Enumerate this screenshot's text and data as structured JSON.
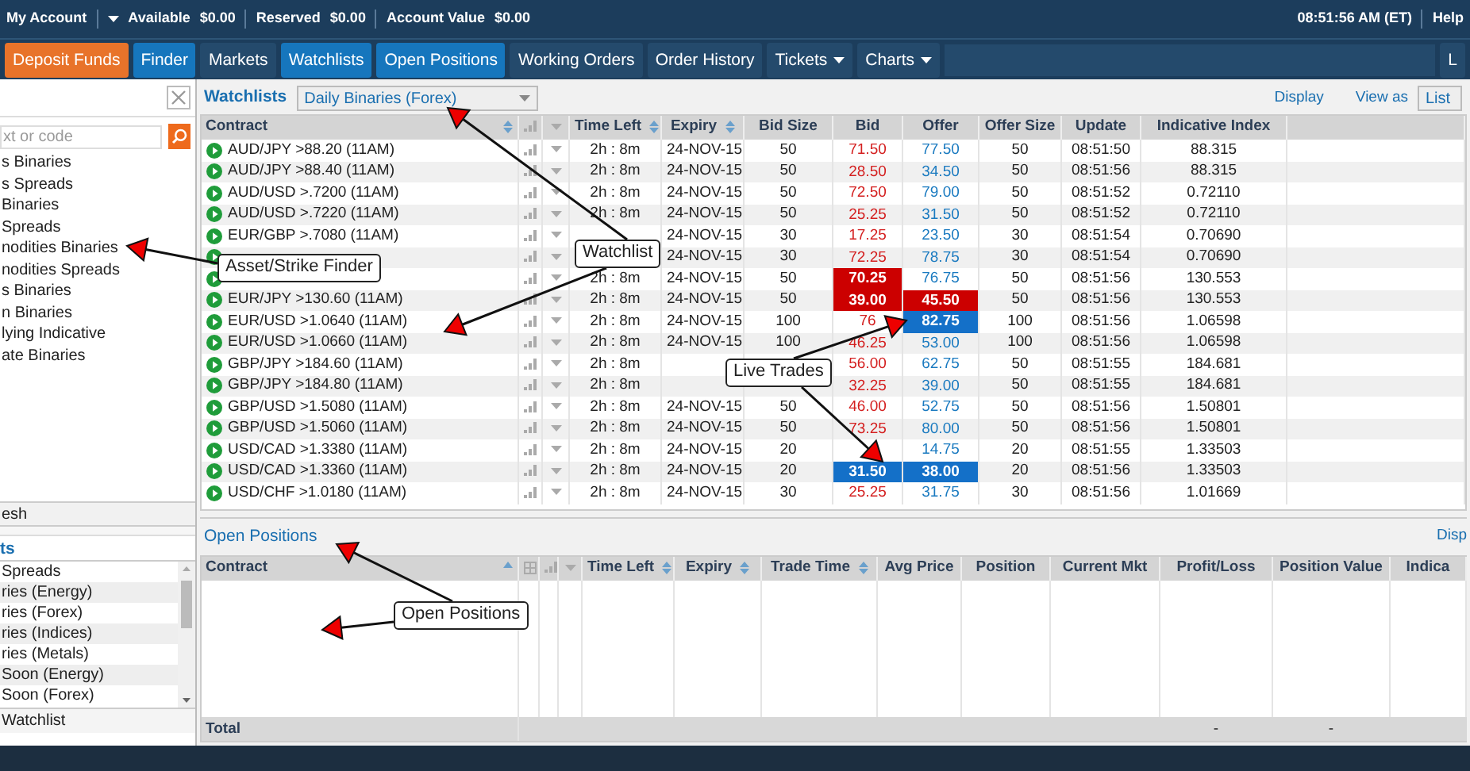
{
  "account_bar": {
    "account_menu": "My Account",
    "balances": [
      {
        "label": "Available",
        "value": "$0.00"
      },
      {
        "label": "Reserved",
        "value": "$0.00"
      },
      {
        "label": "Account Value",
        "value": "$0.00"
      }
    ],
    "clock": "08:51:56 AM (ET)",
    "help": "Help"
  },
  "nav": [
    {
      "label": "Deposit Funds",
      "kind": "action",
      "selected": false,
      "dropdown": false
    },
    {
      "label": "Finder",
      "kind": "tab",
      "selected": true,
      "dropdown": false
    },
    {
      "label": "Markets",
      "kind": "tab",
      "selected": false,
      "dropdown": false
    },
    {
      "label": "Watchlists",
      "kind": "tab",
      "selected": true,
      "dropdown": false
    },
    {
      "label": "Open Positions",
      "kind": "tab",
      "selected": true,
      "dropdown": false
    },
    {
      "label": "Working Orders",
      "kind": "tab",
      "selected": false,
      "dropdown": false
    },
    {
      "label": "Order History",
      "kind": "tab",
      "selected": false,
      "dropdown": false
    },
    {
      "label": "Tickets",
      "kind": "tab",
      "selected": false,
      "dropdown": true
    },
    {
      "label": "Charts",
      "kind": "tab",
      "selected": false,
      "dropdown": true
    },
    {
      "label": "L",
      "kind": "edge",
      "selected": false,
      "dropdown": false
    }
  ],
  "finder_panel": {
    "search_placeholder": "xt or code",
    "categories": [
      "s Binaries",
      "s Spreads",
      "Binaries",
      "Spreads",
      "nodities Binaries",
      "nodities Spreads",
      "s Binaries",
      "n Binaries",
      "lying Indicative",
      "ate Binaries"
    ],
    "refresh": "esh",
    "watchlists_title": "ts",
    "watchlists": [
      "Spreads",
      "ries (Energy)",
      "ries (Forex)",
      "ries (Indices)",
      "ries (Metals)",
      "Soon (Energy)",
      "Soon (Forex)"
    ],
    "footer": "Watchlist"
  },
  "watchlist": {
    "title": "Watchlists",
    "selector": "Daily Binaries (Forex)",
    "display": "Display",
    "view_as_label": "View as",
    "view_as": "List",
    "table": {
      "columns": [
        {
          "kind": "text",
          "label": "Contract",
          "sortable": true
        },
        {
          "kind": "bars"
        },
        {
          "kind": "menu"
        },
        {
          "kind": "text",
          "label": "Time Left",
          "sortable": true
        },
        {
          "kind": "text",
          "label": "Expiry",
          "sortable": true
        },
        {
          "kind": "text",
          "label": "Bid Size",
          "sortable": false
        },
        {
          "kind": "text",
          "label": "Bid",
          "sortable": false
        },
        {
          "kind": "text",
          "label": "Offer",
          "sortable": false
        },
        {
          "kind": "text",
          "label": "Offer Size",
          "sortable": false
        },
        {
          "kind": "text",
          "label": "Update",
          "sortable": false
        },
        {
          "kind": "text",
          "label": "Indicative Index",
          "sortable": false
        }
      ],
      "rows": [
        {
          "contract": "AUD/JPY >88.20 (11AM)",
          "time_left": "2h : 8m",
          "expiry": "24-NOV-15",
          "bid_size": "50",
          "bid": "71.50",
          "bid_fell": false,
          "bid_rose": false,
          "offer": "77.50",
          "offer_fell": false,
          "offer_rose": false,
          "offer_size": "50",
          "update": "08:51:50",
          "index": "88.315"
        },
        {
          "contract": "AUD/JPY >88.40 (11AM)",
          "time_left": "2h : 8m",
          "expiry": "24-NOV-15",
          "bid_size": "50",
          "bid": "28.50",
          "bid_fell": false,
          "bid_rose": false,
          "offer": "34.50",
          "offer_fell": false,
          "offer_rose": false,
          "offer_size": "50",
          "update": "08:51:56",
          "index": "88.315"
        },
        {
          "contract": "AUD/USD >.7200 (11AM)",
          "time_left": "2h : 8m",
          "expiry": "24-NOV-15",
          "bid_size": "50",
          "bid": "72.50",
          "bid_fell": false,
          "bid_rose": false,
          "offer": "79.00",
          "offer_fell": false,
          "offer_rose": false,
          "offer_size": "50",
          "update": "08:51:52",
          "index": "0.72110"
        },
        {
          "contract": "AUD/USD >.7220 (11AM)",
          "time_left": "2h : 8m",
          "expiry": "24-NOV-15",
          "bid_size": "50",
          "bid": "25.25",
          "bid_fell": false,
          "bid_rose": false,
          "offer": "31.50",
          "offer_fell": false,
          "offer_rose": false,
          "offer_size": "50",
          "update": "08:51:52",
          "index": "0.72110"
        },
        {
          "contract": "EUR/GBP >.7080 (11AM)",
          "expiry": "24-NOV-15",
          "bid_size": "30",
          "bid": "17.25",
          "bid_fell": false,
          "bid_rose": false,
          "offer": "23.50",
          "offer_fell": false,
          "offer_rose": false,
          "offer_size": "30",
          "update": "08:51:54",
          "index": "0.70690"
        },
        {
          "expiry": "24-NOV-15",
          "bid_size": "30",
          "bid": "72.25",
          "bid_fell": false,
          "bid_rose": false,
          "offer": "78.75",
          "offer_fell": false,
          "offer_rose": false,
          "offer_size": "30",
          "update": "08:51:54",
          "index": "0.70690"
        },
        {
          "time_left": "2h : 8m",
          "expiry": "24-NOV-15",
          "bid_size": "50",
          "bid": "70.25",
          "bid_fell": true,
          "bid_rose": false,
          "offer": "76.75",
          "offer_fell": false,
          "offer_rose": false,
          "offer_size": "50",
          "update": "08:51:56",
          "index": "130.553"
        },
        {
          "contract": "EUR/JPY >130.60 (11AM)",
          "time_left": "2h : 8m",
          "expiry": "24-NOV-15",
          "bid_size": "50",
          "bid": "39.00",
          "bid_fell": true,
          "bid_rose": false,
          "offer": "45.50",
          "offer_fell": true,
          "offer_rose": false,
          "offer_size": "50",
          "update": "08:51:56",
          "index": "130.553"
        },
        {
          "contract": "EUR/USD >1.0640 (11AM)",
          "time_left": "2h : 8m",
          "expiry": "24-NOV-15",
          "bid_size": "100",
          "bid": "76",
          "bid_fell": false,
          "bid_rose": false,
          "offer": "82.75",
          "offer_fell": false,
          "offer_rose": true,
          "offer_size": "100",
          "update": "08:51:56",
          "index": "1.06598"
        },
        {
          "contract": "EUR/USD >1.0660 (11AM)",
          "time_left": "2h : 8m",
          "expiry": "24-NOV-15",
          "bid_size": "100",
          "bid": "46.25",
          "bid_fell": false,
          "bid_rose": false,
          "offer": "53.00",
          "offer_fell": false,
          "offer_rose": false,
          "offer_size": "100",
          "update": "08:51:56",
          "index": "1.06598"
        },
        {
          "contract": "GBP/JPY >184.60 (11AM)",
          "time_left": "2h : 8m",
          "bid": "56.00",
          "bid_fell": false,
          "bid_rose": false,
          "offer": "62.75",
          "offer_fell": false,
          "offer_rose": false,
          "offer_size": "50",
          "update": "08:51:55",
          "index": "184.681"
        },
        {
          "contract": "GBP/JPY >184.80 (11AM)",
          "time_left": "2h : 8m",
          "bid": "32.25",
          "bid_fell": false,
          "bid_rose": false,
          "offer": "39.00",
          "offer_fell": false,
          "offer_rose": false,
          "offer_size": "50",
          "update": "08:51:55",
          "index": "184.681"
        },
        {
          "contract": "GBP/USD >1.5080 (11AM)",
          "time_left": "2h : 8m",
          "expiry": "24-NOV-15",
          "bid_size": "50",
          "bid": "46.00",
          "bid_fell": false,
          "bid_rose": false,
          "offer": "52.75",
          "offer_fell": false,
          "offer_rose": false,
          "offer_size": "50",
          "update": "08:51:56",
          "index": "1.50801"
        },
        {
          "contract": "GBP/USD >1.5060 (11AM)",
          "time_left": "2h : 8m",
          "expiry": "24-NOV-15",
          "bid_size": "50",
          "bid": "73.25",
          "bid_fell": false,
          "bid_rose": false,
          "offer": "80.00",
          "offer_fell": false,
          "offer_rose": false,
          "offer_size": "50",
          "update": "08:51:56",
          "index": "1.50801"
        },
        {
          "contract": "USD/CAD >1.3380 (11AM)",
          "time_left": "2h : 8m",
          "expiry": "24-NOV-15",
          "bid_size": "20",
          "offer": "14.75",
          "offer_fell": false,
          "offer_rose": false,
          "offer_size": "20",
          "update": "08:51:55",
          "index": "1.33503"
        },
        {
          "contract": "USD/CAD >1.3360 (11AM)",
          "time_left": "2h : 8m",
          "expiry": "24-NOV-15",
          "bid_size": "20",
          "bid": "31.50",
          "bid_fell": false,
          "bid_rose": true,
          "offer": "38.00",
          "offer_fell": false,
          "offer_rose": true,
          "offer_size": "20",
          "update": "08:51:56",
          "index": "1.33503"
        },
        {
          "contract": "USD/CHF >1.0180 (11AM)",
          "time_left": "2h : 8m",
          "expiry": "24-NOV-15",
          "bid_size": "30",
          "bid": "25.25",
          "bid_fell": false,
          "bid_rose": false,
          "offer": "31.75",
          "offer_fell": false,
          "offer_rose": false,
          "offer_size": "30",
          "update": "08:51:56",
          "index": "1.01669"
        }
      ]
    }
  },
  "open_positions": {
    "title": "Open Positions",
    "display": "Disp",
    "columns": [
      {
        "kind": "text",
        "label": "Contract",
        "sortable": true
      },
      {
        "kind": "grid"
      },
      {
        "kind": "bars"
      },
      {
        "kind": "menu"
      },
      {
        "kind": "text",
        "label": "Time Left",
        "sortable": true
      },
      {
        "kind": "text",
        "label": "Expiry",
        "sortable": true
      },
      {
        "kind": "text",
        "label": "Trade Time",
        "sortable": true
      },
      {
        "kind": "text",
        "label": "Avg Price",
        "sortable": false
      },
      {
        "kind": "text",
        "label": "Position",
        "sortable": false
      },
      {
        "kind": "text",
        "label": "Current Mkt",
        "sortable": false
      },
      {
        "kind": "text",
        "label": "Profit/Loss",
        "sortable": false
      },
      {
        "kind": "text",
        "label": "Position Value",
        "sortable": false
      },
      {
        "kind": "text",
        "label": "Indica",
        "sortable": false
      }
    ],
    "total": {
      "label": "Total",
      "profit_loss": "-",
      "position_value": "-"
    }
  },
  "annotations": [
    {
      "text": "Asset/Strike Finder"
    },
    {
      "text": "Watchlist"
    },
    {
      "text": "Live Trades"
    },
    {
      "text": "Open Positions"
    }
  ]
}
